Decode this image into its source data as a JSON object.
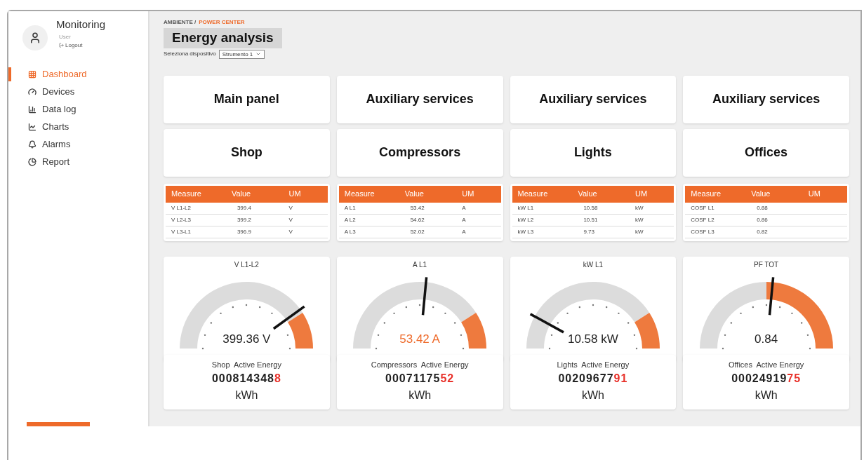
{
  "sidebar": {
    "app_title": "Monitoring",
    "user": {
      "name": "User",
      "logout": "Logout"
    },
    "items": [
      {
        "label": "Dashboard",
        "selected": true
      },
      {
        "label": "Devices",
        "selected": false
      },
      {
        "label": "Data log",
        "selected": false
      },
      {
        "label": "Charts",
        "selected": false
      },
      {
        "label": "Alarms",
        "selected": false
      },
      {
        "label": "Report",
        "selected": false
      }
    ]
  },
  "breadcrumb": [
    {
      "label": "AMBIENTE /",
      "current": false
    },
    {
      "label": "POWER CENTER",
      "current": true
    }
  ],
  "page_title": "Energy analysis",
  "device_select": {
    "label": "Seleziona dispositivo",
    "value": "Strumento 1"
  },
  "panels": [
    "Main panel",
    "Auxiliary services",
    "Auxiliary services",
    "Auxiliary services"
  ],
  "sections": [
    "Shop",
    "Compressors",
    "Lights",
    "Offices"
  ],
  "tables": [
    {
      "columns": [
        "Measure",
        "Value",
        "UM"
      ],
      "rows": [
        [
          "V L1-L2",
          "399.4",
          "V"
        ],
        [
          "V L2-L3",
          "399.2",
          "V"
        ],
        [
          "V L3-L1",
          "396.9",
          "V"
        ]
      ]
    },
    {
      "columns": [
        "Measure",
        "Value",
        "UM"
      ],
      "rows": [
        [
          "A L1",
          "53.42",
          "A"
        ],
        [
          "A L2",
          "54.62",
          "A"
        ],
        [
          "A L3",
          "52.02",
          "A"
        ]
      ]
    },
    {
      "columns": [
        "Measure",
        "Value",
        "UM"
      ],
      "rows": [
        [
          "kW L1",
          "10.58",
          "kW"
        ],
        [
          "kW L2",
          "10.51",
          "kW"
        ],
        [
          "kW L3",
          "9.73",
          "kW"
        ]
      ]
    },
    {
      "columns": [
        "Measure",
        "Value",
        "UM"
      ],
      "rows": [
        [
          "COSF L1",
          "0.88",
          null
        ],
        [
          "COSF L2",
          "0.86",
          null
        ],
        [
          "COSF L3",
          "0.82",
          null
        ]
      ]
    }
  ],
  "gauges": [
    {
      "title": "V L1-L2",
      "reading": "399.36 V",
      "level": 0.8,
      "kind": "meter",
      "alert": false
    },
    {
      "title": "A L1",
      "reading": "53.42 A",
      "level": 0.53,
      "kind": "meter",
      "alert": true
    },
    {
      "title": "kW L1",
      "reading": "10.58 kW",
      "level": 0.16,
      "kind": "meter",
      "alert": false
    },
    {
      "title": "PF TOT",
      "reading": "0.84",
      "level": 0.53,
      "kind": "factor",
      "alert": false
    }
  ],
  "counters": [
    {
      "label": "Shop  Active Energy",
      "digits": "000814348",
      "last_digits": "8",
      "unit": "kWh"
    },
    {
      "label": "Compressors  Active Energy",
      "digits": "00071175",
      "last_digits": "52",
      "unit": "kWh"
    },
    {
      "label": "Lights  Active Energy",
      "digits": "00209677",
      "last_digits": "91",
      "unit": "kWh"
    },
    {
      "label": "Offices  Active Energy",
      "digits": "00024919",
      "last_digits": "75",
      "unit": "kWh"
    }
  ]
}
